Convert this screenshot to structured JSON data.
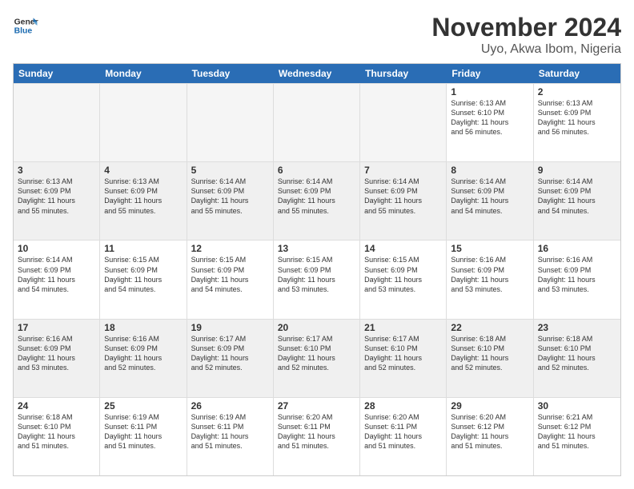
{
  "logo": {
    "line1": "General",
    "line2": "Blue"
  },
  "title": {
    "month_year": "November 2024",
    "location": "Uyo, Akwa Ibom, Nigeria"
  },
  "header_days": [
    "Sunday",
    "Monday",
    "Tuesday",
    "Wednesday",
    "Thursday",
    "Friday",
    "Saturday"
  ],
  "rows": [
    [
      {
        "day": "",
        "info": "",
        "empty": true
      },
      {
        "day": "",
        "info": "",
        "empty": true
      },
      {
        "day": "",
        "info": "",
        "empty": true
      },
      {
        "day": "",
        "info": "",
        "empty": true
      },
      {
        "day": "",
        "info": "",
        "empty": true
      },
      {
        "day": "1",
        "info": "Sunrise: 6:13 AM\nSunset: 6:10 PM\nDaylight: 11 hours\nand 56 minutes.",
        "empty": false
      },
      {
        "day": "2",
        "info": "Sunrise: 6:13 AM\nSunset: 6:09 PM\nDaylight: 11 hours\nand 56 minutes.",
        "empty": false
      }
    ],
    [
      {
        "day": "3",
        "info": "Sunrise: 6:13 AM\nSunset: 6:09 PM\nDaylight: 11 hours\nand 55 minutes.",
        "empty": false
      },
      {
        "day": "4",
        "info": "Sunrise: 6:13 AM\nSunset: 6:09 PM\nDaylight: 11 hours\nand 55 minutes.",
        "empty": false
      },
      {
        "day": "5",
        "info": "Sunrise: 6:14 AM\nSunset: 6:09 PM\nDaylight: 11 hours\nand 55 minutes.",
        "empty": false
      },
      {
        "day": "6",
        "info": "Sunrise: 6:14 AM\nSunset: 6:09 PM\nDaylight: 11 hours\nand 55 minutes.",
        "empty": false
      },
      {
        "day": "7",
        "info": "Sunrise: 6:14 AM\nSunset: 6:09 PM\nDaylight: 11 hours\nand 55 minutes.",
        "empty": false
      },
      {
        "day": "8",
        "info": "Sunrise: 6:14 AM\nSunset: 6:09 PM\nDaylight: 11 hours\nand 54 minutes.",
        "empty": false
      },
      {
        "day": "9",
        "info": "Sunrise: 6:14 AM\nSunset: 6:09 PM\nDaylight: 11 hours\nand 54 minutes.",
        "empty": false
      }
    ],
    [
      {
        "day": "10",
        "info": "Sunrise: 6:14 AM\nSunset: 6:09 PM\nDaylight: 11 hours\nand 54 minutes.",
        "empty": false
      },
      {
        "day": "11",
        "info": "Sunrise: 6:15 AM\nSunset: 6:09 PM\nDaylight: 11 hours\nand 54 minutes.",
        "empty": false
      },
      {
        "day": "12",
        "info": "Sunrise: 6:15 AM\nSunset: 6:09 PM\nDaylight: 11 hours\nand 54 minutes.",
        "empty": false
      },
      {
        "day": "13",
        "info": "Sunrise: 6:15 AM\nSunset: 6:09 PM\nDaylight: 11 hours\nand 53 minutes.",
        "empty": false
      },
      {
        "day": "14",
        "info": "Sunrise: 6:15 AM\nSunset: 6:09 PM\nDaylight: 11 hours\nand 53 minutes.",
        "empty": false
      },
      {
        "day": "15",
        "info": "Sunrise: 6:16 AM\nSunset: 6:09 PM\nDaylight: 11 hours\nand 53 minutes.",
        "empty": false
      },
      {
        "day": "16",
        "info": "Sunrise: 6:16 AM\nSunset: 6:09 PM\nDaylight: 11 hours\nand 53 minutes.",
        "empty": false
      }
    ],
    [
      {
        "day": "17",
        "info": "Sunrise: 6:16 AM\nSunset: 6:09 PM\nDaylight: 11 hours\nand 53 minutes.",
        "empty": false
      },
      {
        "day": "18",
        "info": "Sunrise: 6:16 AM\nSunset: 6:09 PM\nDaylight: 11 hours\nand 52 minutes.",
        "empty": false
      },
      {
        "day": "19",
        "info": "Sunrise: 6:17 AM\nSunset: 6:09 PM\nDaylight: 11 hours\nand 52 minutes.",
        "empty": false
      },
      {
        "day": "20",
        "info": "Sunrise: 6:17 AM\nSunset: 6:10 PM\nDaylight: 11 hours\nand 52 minutes.",
        "empty": false
      },
      {
        "day": "21",
        "info": "Sunrise: 6:17 AM\nSunset: 6:10 PM\nDaylight: 11 hours\nand 52 minutes.",
        "empty": false
      },
      {
        "day": "22",
        "info": "Sunrise: 6:18 AM\nSunset: 6:10 PM\nDaylight: 11 hours\nand 52 minutes.",
        "empty": false
      },
      {
        "day": "23",
        "info": "Sunrise: 6:18 AM\nSunset: 6:10 PM\nDaylight: 11 hours\nand 52 minutes.",
        "empty": false
      }
    ],
    [
      {
        "day": "24",
        "info": "Sunrise: 6:18 AM\nSunset: 6:10 PM\nDaylight: 11 hours\nand 51 minutes.",
        "empty": false
      },
      {
        "day": "25",
        "info": "Sunrise: 6:19 AM\nSunset: 6:11 PM\nDaylight: 11 hours\nand 51 minutes.",
        "empty": false
      },
      {
        "day": "26",
        "info": "Sunrise: 6:19 AM\nSunset: 6:11 PM\nDaylight: 11 hours\nand 51 minutes.",
        "empty": false
      },
      {
        "day": "27",
        "info": "Sunrise: 6:20 AM\nSunset: 6:11 PM\nDaylight: 11 hours\nand 51 minutes.",
        "empty": false
      },
      {
        "day": "28",
        "info": "Sunrise: 6:20 AM\nSunset: 6:11 PM\nDaylight: 11 hours\nand 51 minutes.",
        "empty": false
      },
      {
        "day": "29",
        "info": "Sunrise: 6:20 AM\nSunset: 6:12 PM\nDaylight: 11 hours\nand 51 minutes.",
        "empty": false
      },
      {
        "day": "30",
        "info": "Sunrise: 6:21 AM\nSunset: 6:12 PM\nDaylight: 11 hours\nand 51 minutes.",
        "empty": false
      }
    ]
  ]
}
